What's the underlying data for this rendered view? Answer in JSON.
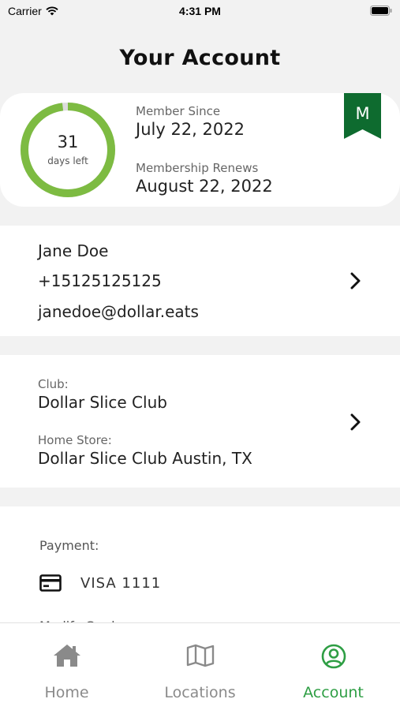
{
  "status_bar": {
    "carrier": "Carrier",
    "time": "4:31 PM"
  },
  "page_title": "Your Account",
  "membership": {
    "days_left": "31",
    "days_left_label": "days left",
    "days_fraction": 0.98,
    "member_since_label": "Member Since",
    "member_since": "July 22, 2022",
    "renews_label": "Membership Renews",
    "renews": "August 22, 2022",
    "badge_letter": "M"
  },
  "profile": {
    "name": "Jane Doe",
    "phone": "+15125125125",
    "email": "janedoe@dollar.eats"
  },
  "club": {
    "club_label": "Club:",
    "club_name": "Dollar Slice Club",
    "store_label": "Home Store:",
    "store_name": "Dollar Slice Club Austin, TX"
  },
  "payment": {
    "label": "Payment:",
    "card_text": "VISA  1111",
    "modify_label": "Modify Card"
  },
  "tabs": [
    {
      "label": "Home",
      "icon": "home-icon",
      "active": false
    },
    {
      "label": "Locations",
      "icon": "map-icon",
      "active": false
    },
    {
      "label": "Account",
      "icon": "account-icon",
      "active": true
    }
  ],
  "colors": {
    "accent_green": "#2e9e44",
    "ring_green": "#7dbb42",
    "badge_green": "#0e6b2f",
    "inactive_gray": "#8a8a8a"
  }
}
